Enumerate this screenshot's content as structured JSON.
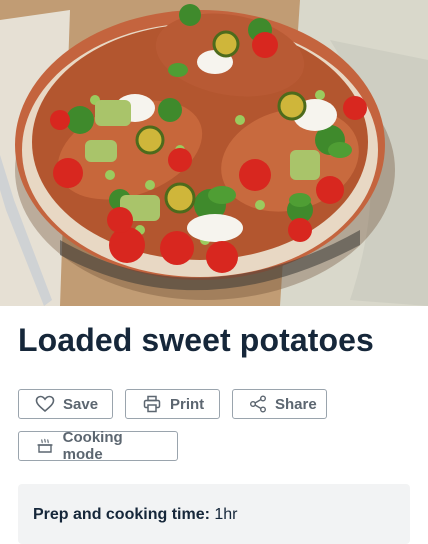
{
  "recipe": {
    "title": "Loaded sweet potatoes"
  },
  "actions": {
    "save_label": "Save",
    "print_label": "Print",
    "share_label": "Share",
    "cooking_mode_label": "Cooking mode"
  },
  "info": {
    "prep_label": "Prep and cooking time:",
    "prep_value": "1hr"
  },
  "icons": {
    "save": "heart-icon",
    "print": "printer-icon",
    "share": "share-icon",
    "cooking_mode": "pot-icon"
  },
  "colors": {
    "title": "#16273a",
    "button_text": "#5c6670",
    "button_border": "#9aa4ad",
    "info_bg": "#f2f3f4"
  }
}
